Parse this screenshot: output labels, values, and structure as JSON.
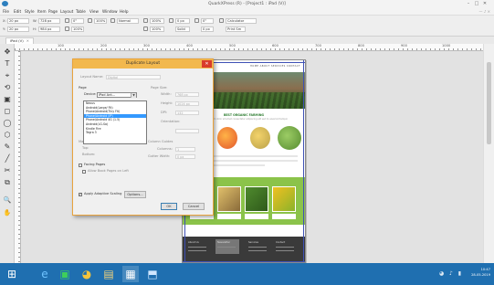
{
  "window": {
    "title": "QuarkXPress (R) - [Project1 : iPad (V)]",
    "controls": [
      "–",
      "□",
      "✕"
    ]
  },
  "menu": {
    "items": [
      "File",
      "Edit",
      "Style",
      "Item",
      "Page",
      "Layout",
      "Table",
      "View",
      "Window",
      "Help"
    ],
    "help_right": "— ♪ ×"
  },
  "measurements": {
    "x": "20 px",
    "y": "20 px",
    "w": "728 px",
    "h": "984 px",
    "angle": "0°",
    "scale": "100%",
    "opacity": "100%",
    "style": "Normal",
    "tint": "100%",
    "tint2": "100%",
    "stroke": "0 px",
    "stroke_style": "Solid",
    "corner": "0°",
    "corner_px": "0 px",
    "font_name": "Calculator",
    "font_size": "Print Sm"
  },
  "tab": {
    "label": "iPad (V)",
    "close": "✕"
  },
  "ruler": {
    "numbers": [
      "0",
      "100",
      "200",
      "300",
      "400",
      "500",
      "600",
      "700",
      "800",
      "900",
      "1000"
    ]
  },
  "tools": [
    "✥",
    "T",
    "⌖",
    "⟲",
    "▣",
    "◻",
    "◯",
    "⬡",
    "✎",
    "╱",
    "✂",
    "⧉",
    "🔍",
    "✋"
  ],
  "site": {
    "logo": "logo",
    "nav": "HOME  ABOUT  SERVICES  CONTACT",
    "section_title": "BEST ORGANIC FARMING",
    "section_sub": "Lorem ipsum dolor sit amet consectetur adipiscing elit sed do eiusmod tempor",
    "footer_cols": [
      "About Us",
      "Newsletter",
      "Services",
      "Contact"
    ]
  },
  "dialog": {
    "title": "Duplicate Layout",
    "close": "✕",
    "layout_name_label": "Layout Name:",
    "layout_name_value": "Digital",
    "page_label": "Page",
    "device_label": "Device:",
    "device_value": "iPad Ant...",
    "page_size_label": "Page Size:",
    "width_label": "Width:",
    "width_value": "768 px",
    "height_label": "Height:",
    "height_value": "1024 px",
    "dpi_label": "DPI:",
    "dpi_value": "132",
    "orientation_label": "Orientation:",
    "options": [
      "Nexus",
      "Android(Large/ Fit)",
      "Phone/Android(Tiny Fit)",
      "Phone/Android (iP)",
      "Phone/Android 4G (1.5)",
      "Android(LG-Sa)",
      "Kindle Fire",
      "Tegra 3"
    ],
    "selected_index": 3,
    "margin_label": "Margin Guides",
    "margin_top": "Top:",
    "margin_bottom": "Bottom:",
    "column_guides_label": "Column Guides",
    "columns_label": "Columns:",
    "columns_value": "1",
    "gutter_label": "Gutter Width:",
    "gutter_value": "0 px",
    "facing_pages_label": "Facing Pages",
    "allow_pages_label": "Allow Book Pages on Left",
    "adaptive_scaling_label": "Apply Adaptive Scaling",
    "options_button": "Options...",
    "ok_button": "OK",
    "cancel_button": "Cancel"
  },
  "taskbar": {
    "apps": [
      "⊞",
      "e",
      "▣",
      "◕",
      "▤",
      "▦",
      "⬒"
    ],
    "time": "10:47",
    "date": "28-05-2019",
    "tray_icons": "◕ ♪ ▮"
  },
  "colors": {
    "dialog_title": "#f2b84e",
    "close_red": "#d93c2c",
    "selection_blue": "#3399ff",
    "taskbar": "#1f6fb0",
    "site_green": "#8bc34a"
  }
}
